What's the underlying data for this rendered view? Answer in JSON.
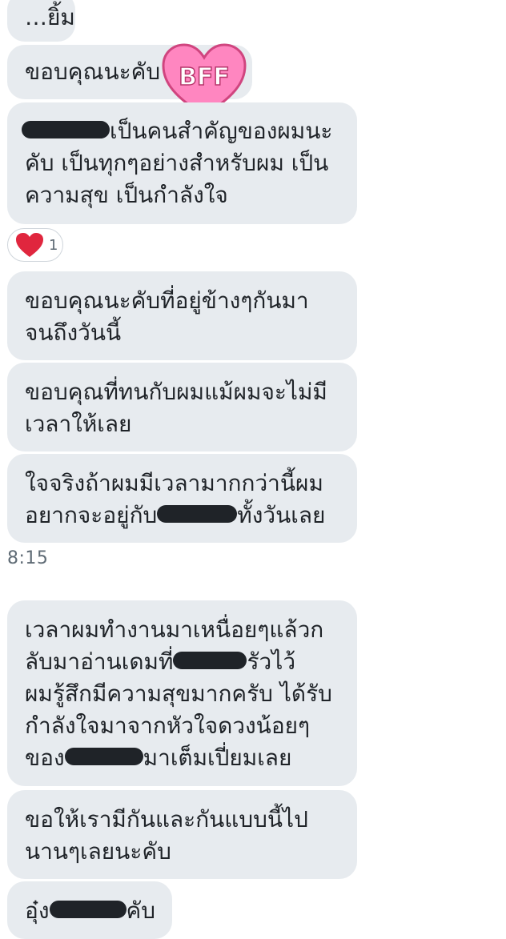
{
  "messages": [
    {
      "lines": [
        "…ยิ้ม"
      ]
    },
    {
      "lines": [
        "ขอบคุณนะคับ"
      ]
    },
    {
      "lines": [
        "เป็นคนสำคัญของผมนะ",
        "คับ เป็นทุกๆอย่างสำหรับผม เป็น",
        "ความสุข เป็นกำลังใจ"
      ]
    },
    {
      "lines": [
        "ขอบคุณนะคับที่อยู่ข้างๆกันมา",
        "จนถึงวันนี้"
      ]
    },
    {
      "lines": [
        "ขอบคุณที่ทนกับผมแม้ผมจะไม่มี",
        "เวลาให้เลย"
      ]
    },
    {
      "lines_a": [
        "ใจจริงถ้าผมมีเวลามากกว่านี้ผม"
      ],
      "line2_pre": "อยากจะอยู่กับ",
      "line2_post": "ทั้งวันเลย"
    },
    {
      "line1": "เวลาผมทำงานมาเหนื่อยๆแล้วก",
      "line2_pre": "ลับมาอ่านเดมที่",
      "line2_post": "รัวไว้",
      "line3": "ผมรู้สึกมีความสุขมากครับ ได้รับ",
      "line4": "กำลังใจมาจากหัวใจดวงน้อยๆ",
      "line5_pre": "ของ",
      "line5_post": "มาเต็มเปี่ยมเลย"
    },
    {
      "lines": [
        "ขอให้เรามีกันและกันแบบนี้ไป",
        "นานๆเลยนะคับ"
      ]
    },
    {
      "pre": "อุ๋ง",
      "post": "คับ"
    }
  ],
  "reaction": {
    "icon": "heart-icon",
    "count": "1",
    "color": "#e0263e"
  },
  "timestamp": "8:15",
  "sticker": {
    "text": "BFF",
    "color": "#ff7fbf",
    "icon": "bff-heart-sticker-icon"
  },
  "colors": {
    "bubble": "#e7ebef",
    "text": "#1f2328",
    "muted": "#5f6b75"
  }
}
